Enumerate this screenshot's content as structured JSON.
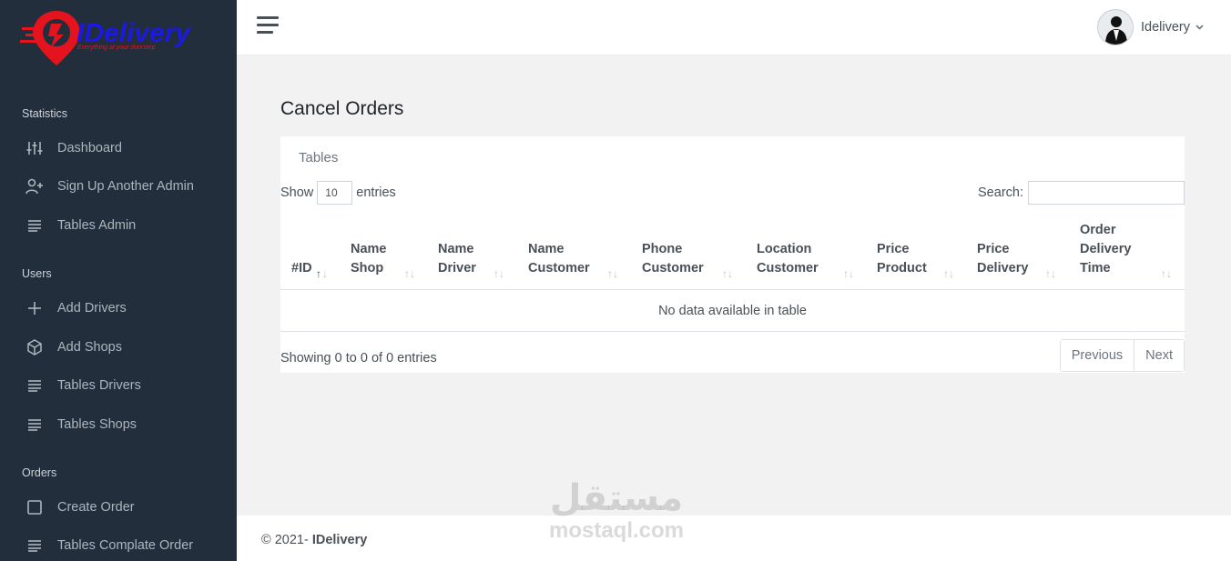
{
  "brand": {
    "logo_text": "iDelivery",
    "tagline": "Everything at your doorstep",
    "colors": {
      "red": "#e3141e",
      "blue": "#1a1ae0"
    }
  },
  "sidebar": {
    "sections": [
      {
        "header": "Statistics",
        "items": [
          {
            "label": "Dashboard",
            "icon": "sliders-icon"
          },
          {
            "label": "Sign Up Another Admin",
            "icon": "user-plus-icon"
          },
          {
            "label": "Tables Admin",
            "icon": "list-icon"
          }
        ]
      },
      {
        "header": "Users",
        "items": [
          {
            "label": "Add Drivers",
            "icon": "plus-icon"
          },
          {
            "label": "Add Shops",
            "icon": "box-icon"
          },
          {
            "label": "Tables Drivers",
            "icon": "list-icon"
          },
          {
            "label": "Tables Shops",
            "icon": "list-icon"
          }
        ]
      },
      {
        "header": "Orders",
        "items": [
          {
            "label": "Create Order",
            "icon": "square-icon"
          },
          {
            "label": "Tables Complate Order",
            "icon": "list-icon"
          }
        ]
      }
    ]
  },
  "topbar": {
    "user_name": "Idelivery"
  },
  "page": {
    "title": "Cancel Orders",
    "card_title": "Tables",
    "show_label": "Show",
    "entries_label": "entries",
    "page_length": "10",
    "search_label": "Search:",
    "search_value": "",
    "columns": [
      "#ID",
      "Name Shop",
      "Name Driver",
      "Name Customer",
      "Phone Customer",
      "Location Customer",
      "Price Product",
      "Price Delivery",
      "Order Delivery Time"
    ],
    "empty_message": "No data available in table",
    "info": "Showing 0 to 0 of 0 entries",
    "prev_label": "Previous",
    "next_label": "Next"
  },
  "footer": {
    "prefix": "© 2021- ",
    "brand": "IDelivery"
  },
  "watermark": {
    "arabic": "مستقل",
    "latin": "mostaql.com"
  }
}
